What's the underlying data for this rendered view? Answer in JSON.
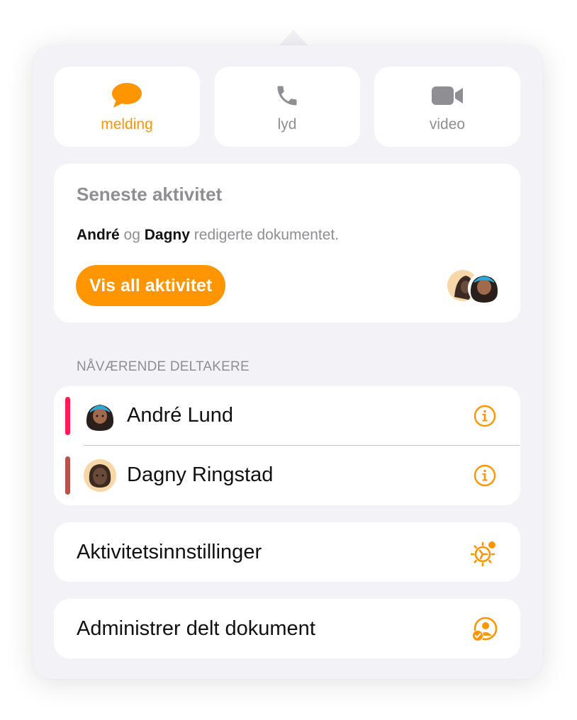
{
  "colors": {
    "accent": "#ff9500",
    "andre_bar": "#ff1a5a",
    "dagny_bar": "#b2554a",
    "secondary_text": "#8e8e93"
  },
  "comm": {
    "message_label": "melding",
    "audio_label": "lyd",
    "video_label": "video"
  },
  "activity": {
    "title": "Seneste aktivitet",
    "name1": "André",
    "conj": "og",
    "name2": "Dagny",
    "rest": "redigerte dokumentet.",
    "button_label": "Vis all aktivitet"
  },
  "participants": {
    "header": "NÅVÆRENDE DELTAKERE",
    "items": [
      {
        "name": "André Lund",
        "icon": "info-icon"
      },
      {
        "name": "Dagny Ringstad",
        "icon": "info-icon"
      }
    ]
  },
  "menu": {
    "activity_settings": "Aktivitetsinnstillinger",
    "manage_shared": "Administrer delt dokument"
  }
}
